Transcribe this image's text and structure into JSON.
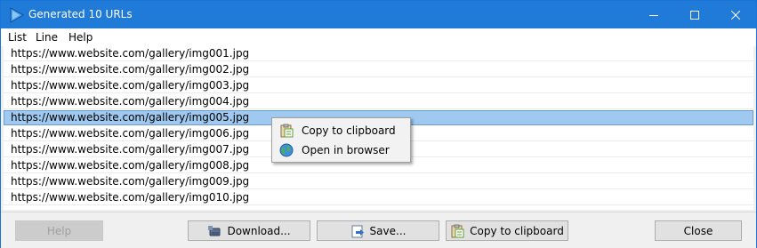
{
  "window": {
    "title": "Generated 10 URLs",
    "controls": {
      "minimize": "minimize-icon",
      "maximize": "maximize-icon",
      "close": "close-icon"
    }
  },
  "menu": [
    "List",
    "Line",
    "Help"
  ],
  "urls": [
    "https://www.website.com/gallery/img001.jpg",
    "https://www.website.com/gallery/img002.jpg",
    "https://www.website.com/gallery/img003.jpg",
    "https://www.website.com/gallery/img004.jpg",
    "https://www.website.com/gallery/img005.jpg",
    "https://www.website.com/gallery/img006.jpg",
    "https://www.website.com/gallery/img007.jpg",
    "https://www.website.com/gallery/img008.jpg",
    "https://www.website.com/gallery/img009.jpg",
    "https://www.website.com/gallery/img010.jpg"
  ],
  "selected_index": 4,
  "context_menu": [
    {
      "label": "Copy to clipboard",
      "icon": "clipboard-icon"
    },
    {
      "label": "Open in browser",
      "icon": "globe-icon"
    }
  ],
  "buttons": {
    "help": "Help",
    "download": "Download...",
    "save": "Save...",
    "copy": "Copy to clipboard",
    "close": "Close"
  },
  "colors": {
    "titlebar": "#1f7ad8",
    "selection": "#9fc9f0"
  }
}
